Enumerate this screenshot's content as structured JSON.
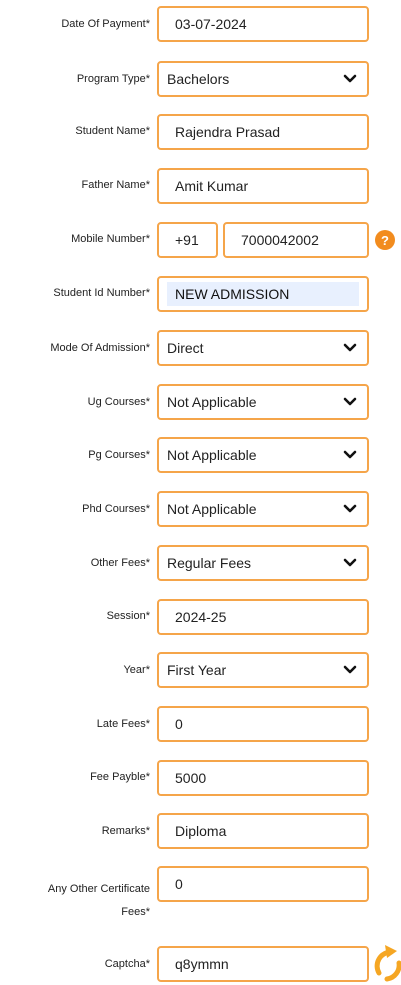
{
  "form": {
    "date_of_payment": {
      "label": "Date Of Payment*",
      "value": "03-07-2024"
    },
    "program_type": {
      "label": "Program Type*",
      "value": "Bachelors"
    },
    "student_name": {
      "label": "Student Name*",
      "value": "Rajendra Prasad"
    },
    "father_name": {
      "label": "Father Name*",
      "value": "Amit Kumar"
    },
    "mobile_number": {
      "label": "Mobile Number*",
      "code": "+91",
      "value": "7000042002",
      "help": "?"
    },
    "student_id_number": {
      "label": "Student Id Number*",
      "value": "NEW ADMISSION"
    },
    "mode_of_admission": {
      "label": "Mode Of Admission*",
      "value": "Direct"
    },
    "ug_courses": {
      "label": "Ug Courses*",
      "value": "Not Applicable"
    },
    "pg_courses": {
      "label": "Pg Courses*",
      "value": "Not Applicable"
    },
    "phd_courses": {
      "label": "Phd Courses*",
      "value": "Not Applicable"
    },
    "other_fees": {
      "label": "Other Fees*",
      "value": "Regular Fees"
    },
    "session": {
      "label": "Session*",
      "value": "2024-25"
    },
    "year": {
      "label": "Year*",
      "value": "First Year"
    },
    "late_fees": {
      "label": "Late Fees*",
      "value": "0"
    },
    "fee_payble": {
      "label": "Fee Payble*",
      "value": "5000"
    },
    "remarks": {
      "label": "Remarks*",
      "value": "Diploma"
    },
    "any_other_certificate_fees": {
      "label_line1": "Any Other Certificate",
      "label_line2": "Fees*",
      "value": "0"
    },
    "captcha": {
      "label": "Captcha*",
      "value": "q8ymmn"
    }
  },
  "colors": {
    "border": "#f5a54a",
    "accent": "#f28c1e",
    "readonly_bg": "#e8f0fe"
  },
  "icons": {
    "select_arrow": "chevron-down-icon",
    "help": "help-icon",
    "refresh": "refresh-icon"
  }
}
